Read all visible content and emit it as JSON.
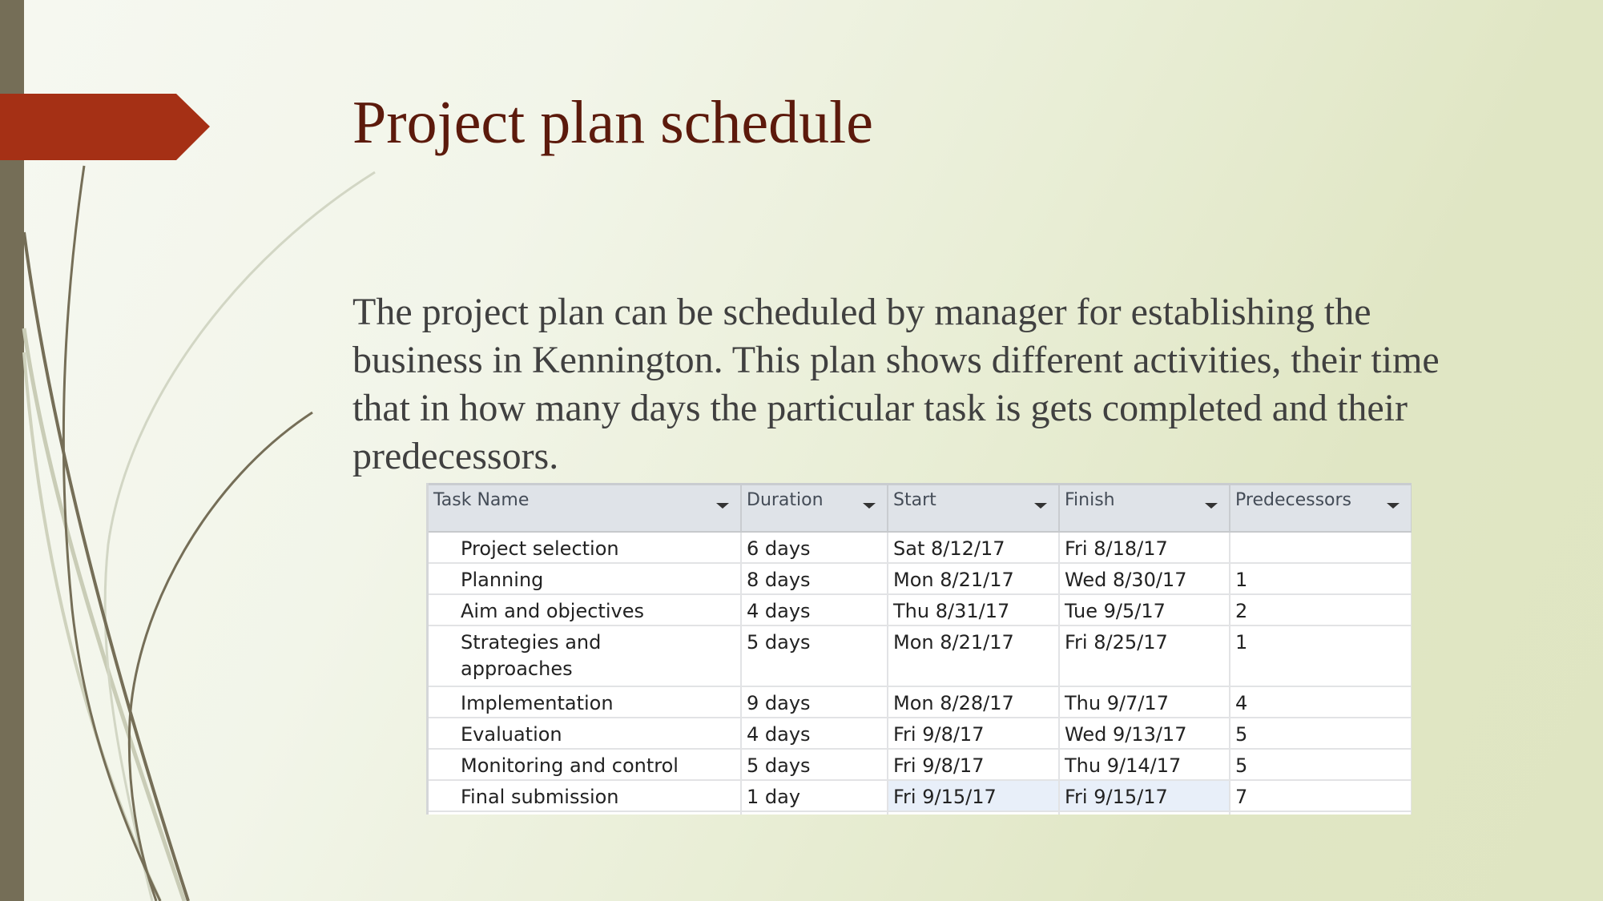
{
  "slide": {
    "title": "Project plan schedule",
    "body": "The project plan can be scheduled by manager for establishing the business in Kennington. This plan shows different activities, their time that in how many days the particular task is gets completed and their predecessors.",
    "colors": {
      "title": "#5c1a0c",
      "banner": "#a53015",
      "side_strip": "#756e57",
      "body_text": "#404040"
    }
  },
  "table": {
    "columns": [
      "Task Name",
      "Duration",
      "Start",
      "Finish",
      "Predecessors"
    ],
    "rows": [
      {
        "task": "Project selection",
        "duration": "6 days",
        "start": "Sat 8/12/17",
        "finish": "Fri 8/18/17",
        "predecessors": ""
      },
      {
        "task": "Planning",
        "duration": "8 days",
        "start": "Mon 8/21/17",
        "finish": "Wed 8/30/17",
        "predecessors": "1"
      },
      {
        "task": "Aim and objectives",
        "duration": "4 days",
        "start": "Thu 8/31/17",
        "finish": "Tue 9/5/17",
        "predecessors": "2"
      },
      {
        "task": "Strategies and approaches",
        "duration": "5 days",
        "start": "Mon 8/21/17",
        "finish": "Fri 8/25/17",
        "predecessors": "1"
      },
      {
        "task": "Implementation",
        "duration": "9 days",
        "start": "Mon 8/28/17",
        "finish": "Thu 9/7/17",
        "predecessors": "4"
      },
      {
        "task": "Evaluation",
        "duration": "4 days",
        "start": "Fri 9/8/17",
        "finish": "Wed 9/13/17",
        "predecessors": "5"
      },
      {
        "task": "Monitoring and control",
        "duration": "5 days",
        "start": "Fri 9/8/17",
        "finish": "Thu 9/14/17",
        "predecessors": "5"
      },
      {
        "task": "Final submission",
        "duration": "1 day",
        "start": "Fri 9/15/17",
        "finish": "Fri 9/15/17",
        "predecessors": "7"
      }
    ]
  }
}
